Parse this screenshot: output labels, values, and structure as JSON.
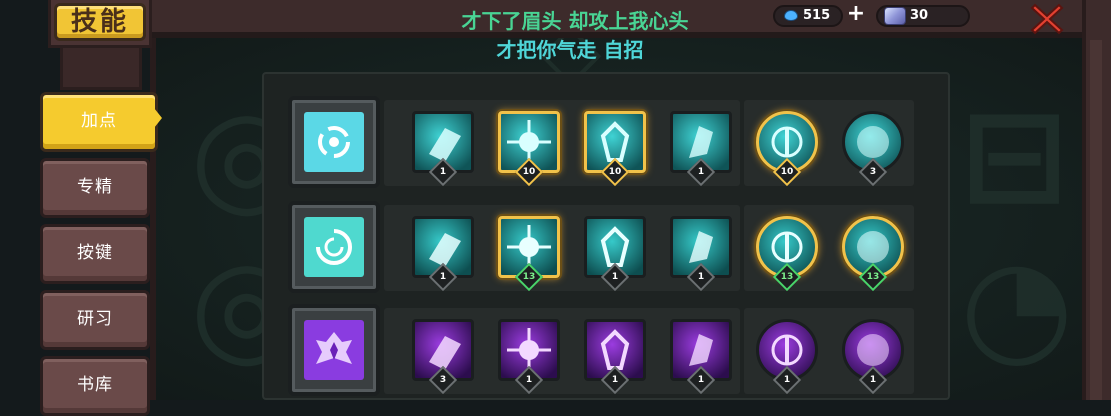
{
  "title": "技能",
  "subtitle_line1": "才下了眉头 却攻上我心头",
  "subtitle_line2": "才把你气走 自招",
  "currency": {
    "gems": "515",
    "coins": "30",
    "plus": "+"
  },
  "tabs": [
    {
      "label": "加点",
      "active": true
    },
    {
      "label": "专精",
      "active": false
    },
    {
      "label": "按键",
      "active": false
    },
    {
      "label": "研习",
      "active": false
    },
    {
      "label": "书库",
      "active": false
    }
  ],
  "colors": {
    "accent": "#f5cb2e",
    "cyan": "#3fd3d4",
    "purple": "#9b3ce0",
    "gold_border": "#f1c24a",
    "green_level": "#49d46a"
  },
  "skill_rows": [
    {
      "main_icon": "vortex-icon",
      "skills": [
        {
          "icon": "crystal-shard-icon",
          "level": "1",
          "style": "normal"
        },
        {
          "icon": "frost-burst-icon",
          "level": "10",
          "style": "gold"
        },
        {
          "icon": "rune-sigil-icon",
          "level": "10",
          "style": "gold"
        },
        {
          "icon": "ice-crystal-icon",
          "level": "1",
          "style": "normal"
        },
        {
          "icon": "key-orb-icon",
          "level": "10",
          "style": "gold-round"
        },
        {
          "icon": "water-orb-icon",
          "level": "3",
          "style": "round"
        }
      ]
    },
    {
      "main_icon": "spiral-icon",
      "skills": [
        {
          "icon": "wind-slash-icon",
          "level": "1",
          "style": "normal"
        },
        {
          "icon": "blade-strike-icon",
          "level": "13",
          "style": "gold-green"
        },
        {
          "icon": "wave-icon",
          "level": "1",
          "style": "normal"
        },
        {
          "icon": "snowflake-icon",
          "level": "1",
          "style": "normal"
        },
        {
          "icon": "heart-orb-icon",
          "level": "13",
          "style": "gold-round-green"
        },
        {
          "icon": "lightning-orb-icon",
          "level": "13",
          "style": "gold-round-green"
        }
      ]
    },
    {
      "main_icon": "lotus-crest-icon",
      "skills": [
        {
          "icon": "shadow-claw-icon",
          "level": "3",
          "style": "normal"
        },
        {
          "icon": "dagger-volley-icon",
          "level": "1",
          "style": "normal"
        },
        {
          "icon": "sword-pillar-icon",
          "level": "1",
          "style": "normal"
        },
        {
          "icon": "skull-orb-icon",
          "level": "1",
          "style": "normal"
        },
        {
          "icon": "shadow-bloom-icon",
          "level": "1",
          "style": "round"
        },
        {
          "icon": "void-orb-icon",
          "level": "1",
          "style": "round"
        }
      ]
    }
  ]
}
